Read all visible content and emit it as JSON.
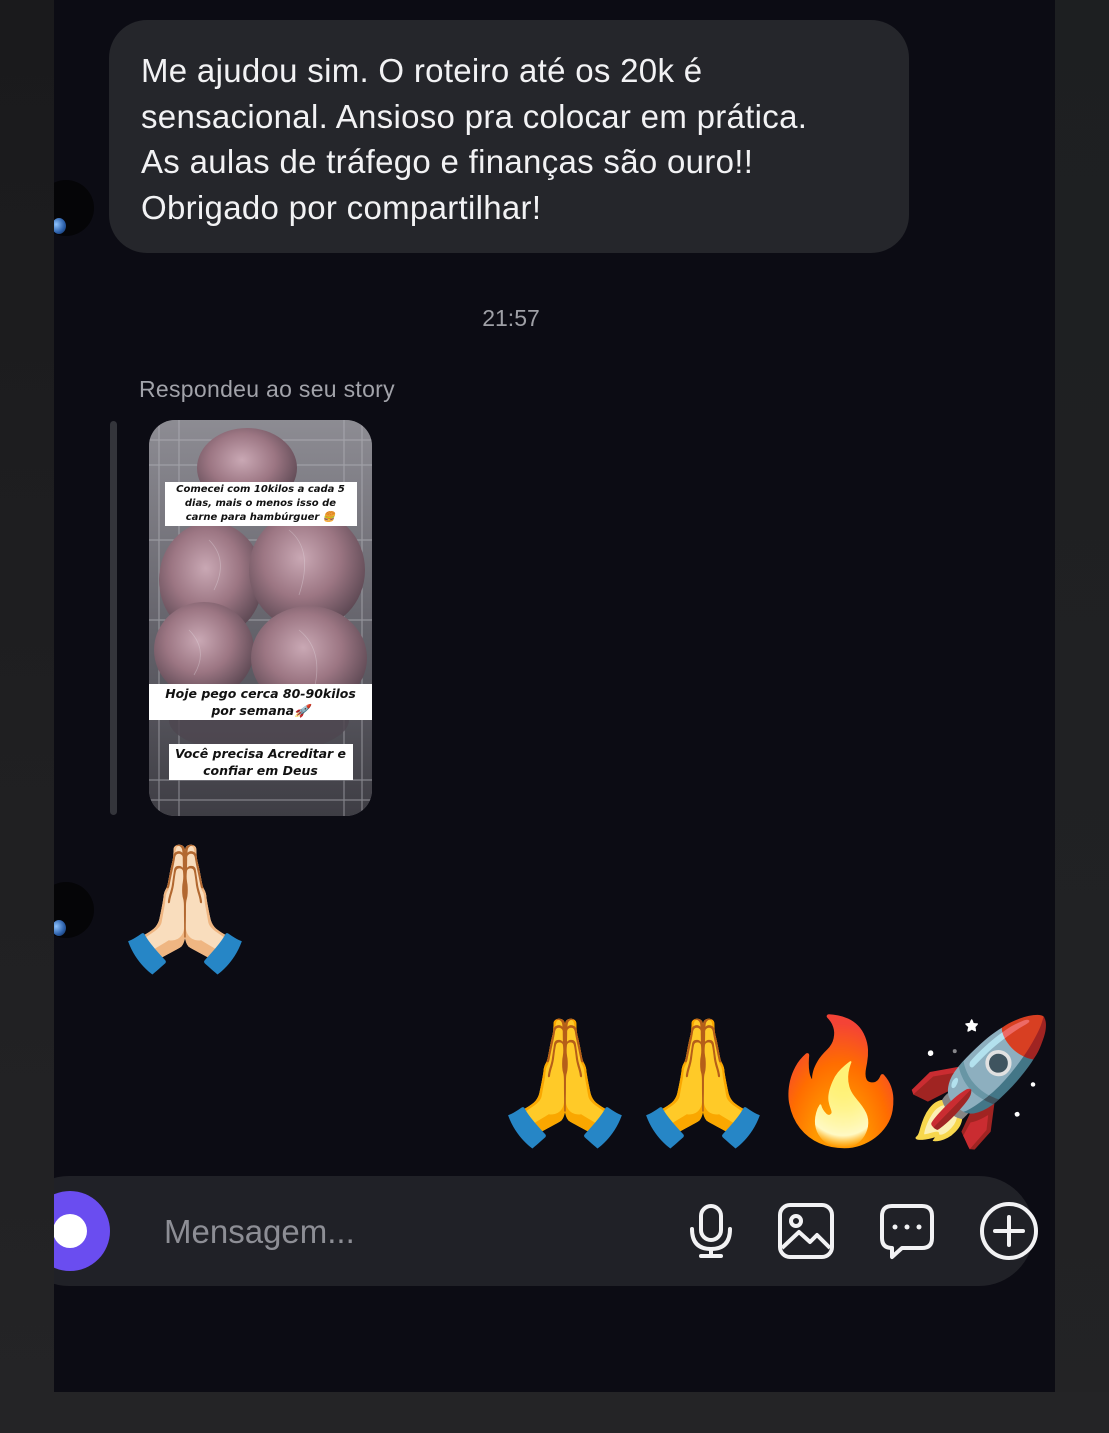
{
  "conversation": {
    "incoming_message": "Me ajudou sim. O roteiro até os 20k é\nsensacional. Ansioso pra colocar em prática.\nAs aulas de tráfego e finanças são ouro!!\nObrigado por compartilhar!",
    "timestamp": "21:57",
    "story_reply_caption": "Respondeu ao seu story",
    "story_preview": {
      "overlay_text_1": "Comecei com 10kilos a cada 5 dias, mais o menos isso de carne para hambúrguer 🍔",
      "overlay_text_2": "Hoje pego cerca 80-90kilos por semana🚀",
      "overlay_text_3": "Você precisa Acreditar e confiar em Deus"
    },
    "received_reaction": "🙏🏻",
    "sent_reactions": [
      "🙏",
      "🙏",
      "🔥",
      "🚀"
    ]
  },
  "composer": {
    "placeholder": "Mensagem...",
    "icons": [
      "camera-icon",
      "microphone-icon",
      "image-icon",
      "sticker-icon",
      "plus-icon"
    ]
  },
  "colors": {
    "chat_background": "#0c0c14",
    "bubble_background": "#25262b",
    "composer_background": "#202127",
    "camera_button": "#6a4df0"
  }
}
